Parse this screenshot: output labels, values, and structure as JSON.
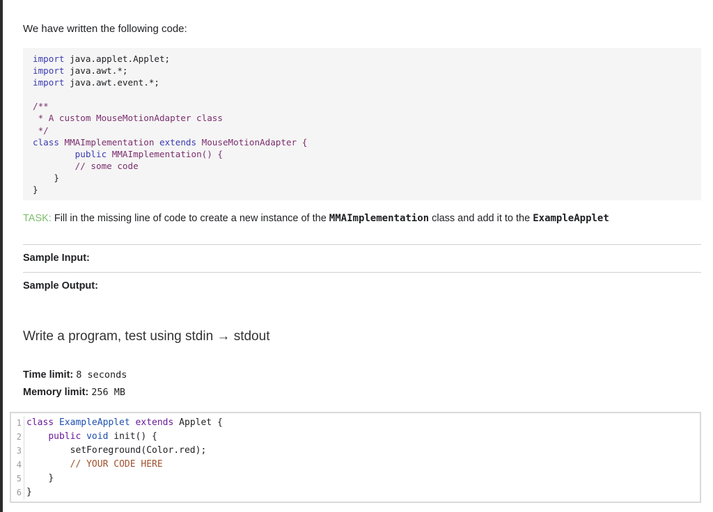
{
  "intro": "We have written the following code:",
  "code": {
    "line1_kw": "import",
    "line1_rest": " java.applet.Applet;",
    "line2_kw": "import",
    "line2_rest": " java.awt.*;",
    "line3_kw": "import",
    "line3_rest": " java.awt.event.*;",
    "line5": "/**",
    "line6": " * A custom MouseMotionAdapter class",
    "line7": " */",
    "line8_kw1": "class",
    "line8_name": " MMAImplementation ",
    "line8_kw2": "extends",
    "line8_rest": " MouseMotionAdapter {",
    "line9_kw": "public",
    "line9_rest": " MMAImplementation() {",
    "line10": "// some code",
    "line11": "}",
    "line12": "}"
  },
  "task": {
    "label": "TASK:",
    "text1": " Fill in the missing line of code to create a new instance of the ",
    "class1": "MMAImplementation",
    "text2": " class and add it to the ",
    "class2": "ExampleApplet"
  },
  "sample_input_label": "Sample Input:",
  "sample_output_label": "Sample Output:",
  "heading": "Write a program, test using stdin → stdout",
  "time_limit": {
    "label": "Time limit:",
    "value": "8 seconds"
  },
  "memory_limit": {
    "label": "Memory limit:",
    "value": "256 MB"
  },
  "editor": {
    "line_numbers": [
      "1",
      "2",
      "3",
      "4",
      "5",
      "6"
    ],
    "l1_kw1": "class",
    "l1_name": " ExampleApplet ",
    "l1_kw2": "extends",
    "l1_rest": " Applet {",
    "l2_kw1": "public",
    "l2_kw2": " void",
    "l2_rest": " init() {",
    "l3": "setForeground(Color.red);",
    "l4": "// YOUR CODE HERE",
    "l5": "}",
    "l6": "}"
  }
}
